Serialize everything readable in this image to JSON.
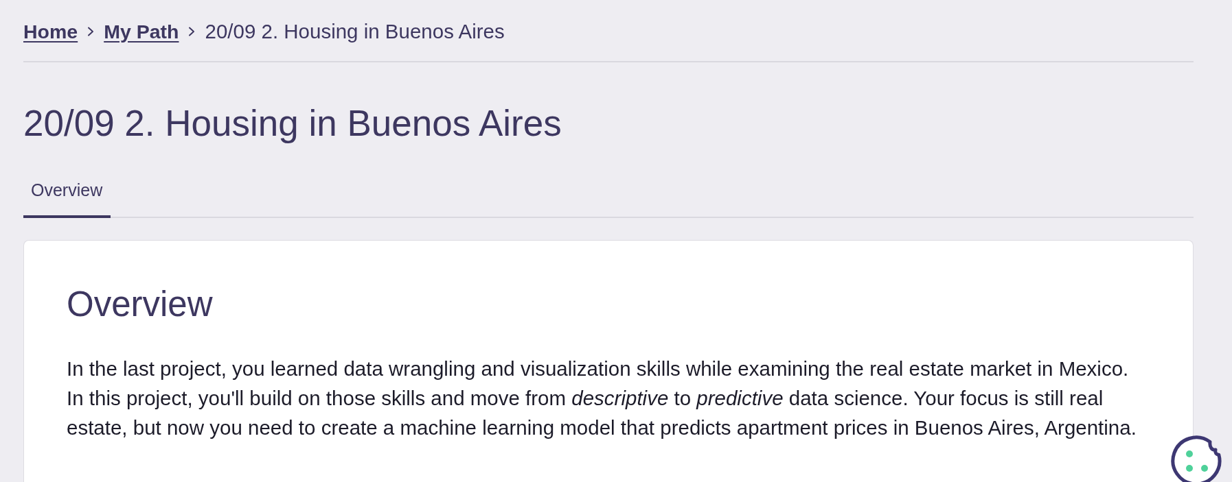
{
  "breadcrumb": {
    "links": [
      "Home",
      "My Path"
    ],
    "current": "20/09 2. Housing in Buenos Aires"
  },
  "title": "20/09 2. Housing in Buenos Aires",
  "tabs": [
    {
      "label": "Overview",
      "selected": true
    }
  ],
  "card": {
    "heading": "Overview",
    "paragraph": "In the last project, you learned data wrangling and visualization skills while examining the real estate market in Mexico. In this project, you'll build on those skills and move from *descriptive* to *predictive* data science. Your focus is still real estate, but now you need to create a machine learning model that predicts apartment prices in Buenos Aires, Argentina."
  }
}
